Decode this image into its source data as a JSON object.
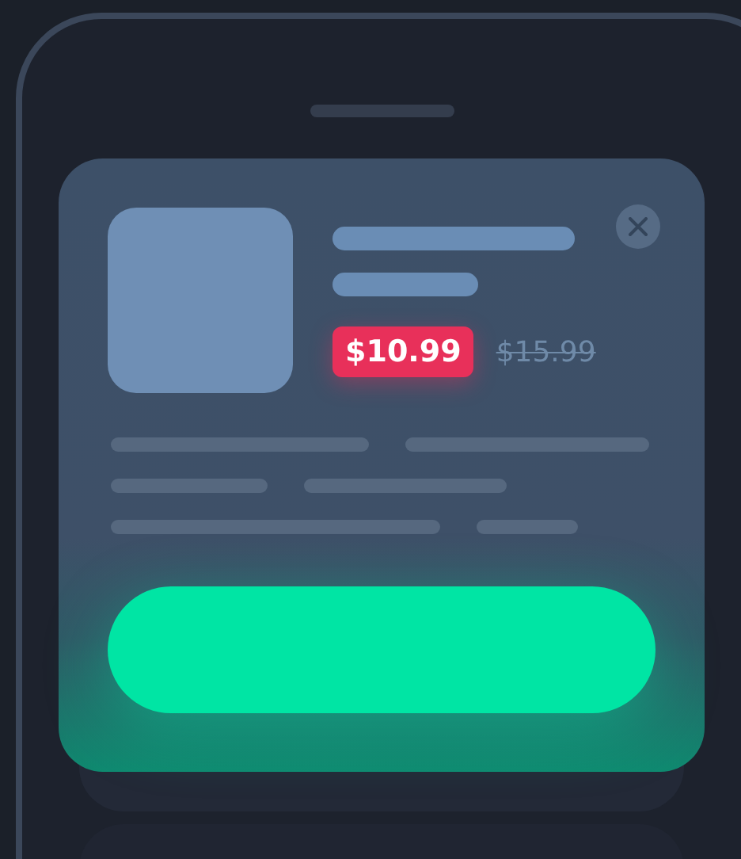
{
  "product": {
    "sale_price": "$10.99",
    "original_price": "$15.99"
  }
}
